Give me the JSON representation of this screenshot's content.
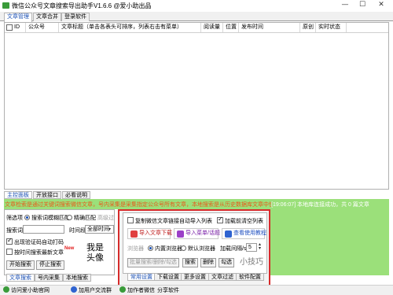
{
  "window": {
    "title": "微信公众号文章搜索导出助手V1.6.6  @爱小助出品",
    "min": "—",
    "max": "☐",
    "close": "✕",
    "accent": "#3a9b3a"
  },
  "top_tabs": [
    "文章管理",
    "文章合并",
    "登录软件"
  ],
  "table": {
    "columns": [
      "ID",
      "公众号",
      "文章标题（单击各表头可排序，列表右击有菜单）",
      "阅读量",
      "位置",
      "发布时间",
      "原创",
      "实时状态"
    ]
  },
  "info_bar": {
    "left": "文章检索是通过关键词搜索微信文章，号内采集是采集指定公众号所有文章，本地搜索是从历史数据库文章中快速筛选文章",
    "right": "[19:06:07] 本地库连接成功，共 0 篇文章",
    "bg": "#9be07a"
  },
  "bottom_tabs": [
    "主控面板",
    "开放接口",
    "必看说明"
  ],
  "left_panel": {
    "match_label": "筛选项",
    "radio1": "搜索词模糊匹配",
    "radio2": "精确匹配",
    "radio3_dis": "高级过",
    "keyword_label": "搜索词",
    "time_label": "时间段",
    "time_value": "全部时间",
    "check1": "出现验证码自动打码",
    "check2": "按时间搜索最新文章",
    "new_badge": "New",
    "start_btn": "开始搜索",
    "stop_btn": "停止搜索",
    "brand_line1": "我是",
    "brand_line2": "头像",
    "tabs": [
      "文章搜索",
      "号内采集",
      "本地搜索"
    ]
  },
  "popup": {
    "check_copy": "复制微信文章链接自动导入列表",
    "check_load": "加载前清空列表",
    "btn_import_dl": "导入文章下载",
    "btn_import_menu": "导入菜单/话题",
    "btn_tutorial": "查看使用教程",
    "browser_label": "浏览器",
    "radio_builtin": "内置浏览器",
    "radio_default": "默认浏览器",
    "interval_label": "加载间隔/s",
    "interval_value": "5",
    "batch_btn": "批量搜索/删除/勾选",
    "btn_search": "搜索",
    "btn_delete": "删除",
    "btn_select": "勾选",
    "tips": "小技巧",
    "tabs": [
      "常用设置",
      "下载设置",
      "更多设置",
      "文章过滤",
      "软件配置"
    ],
    "border": "#d62b2b"
  },
  "status_bar": {
    "item1": "访问爱小助官网",
    "item2": "加用户交流群",
    "item3": "加作者微信",
    "item4": "分享软件"
  }
}
